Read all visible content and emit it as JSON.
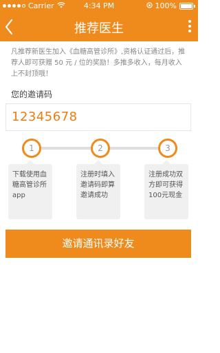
{
  "status_bar": {
    "carrier": "Carrier",
    "time": "4:34 PM",
    "battery": "100%"
  },
  "nav": {
    "title": "推荐医生"
  },
  "description": "凡推荐新医生加入《血糖高管诊所》,资格认证通过后，推荐人即可获赠 50 元 / 位的奖励！多推多收入，每月收入上不封顶哦！",
  "invite_code": {
    "label": "您的邀请码",
    "value": "12345678"
  },
  "steps": [
    {
      "number": "1",
      "text": "下载使用血糖高管诊所app"
    },
    {
      "number": "2",
      "text": "注册时填入邀请码即算邀请成功"
    },
    {
      "number": "3",
      "text": "注册成功双方即可获得100元现金"
    }
  ],
  "invite_button": {
    "label": "邀请通讯录好友"
  },
  "colors": {
    "accent": "#ef8a1c",
    "code_text": "#ef7b0f"
  }
}
